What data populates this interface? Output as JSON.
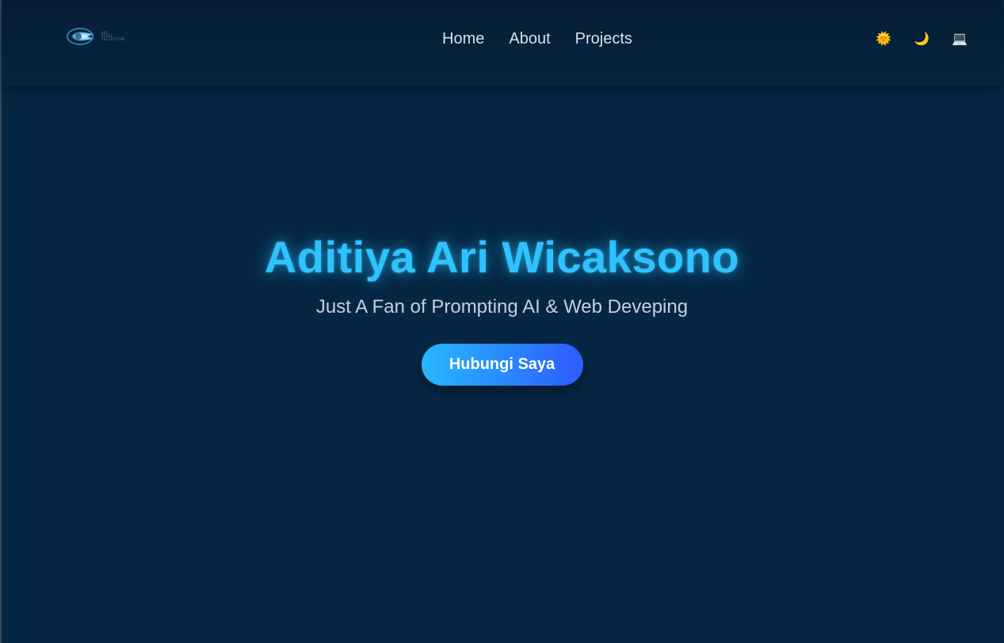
{
  "header": {
    "logo_text": "ARI\nPIXEL\nCOLLECTION",
    "nav": [
      {
        "label": "Home"
      },
      {
        "label": "About"
      },
      {
        "label": "Projects"
      }
    ],
    "theme_toggles": [
      {
        "icon": "sun-icon",
        "glyph": "🌞"
      },
      {
        "icon": "moon-icon",
        "glyph": "🌙"
      },
      {
        "icon": "laptop-icon",
        "glyph": "💻"
      }
    ]
  },
  "hero": {
    "title": "Aditiya Ari Wicaksono",
    "subtitle": "Just A Fan of Prompting AI & Web Deveping",
    "cta_label": "Hubungi Saya"
  },
  "colors": {
    "background": "#062744",
    "accent": "#2ec3ff",
    "button_gradient_start": "#27b8ff",
    "button_gradient_end": "#2d5bff"
  }
}
